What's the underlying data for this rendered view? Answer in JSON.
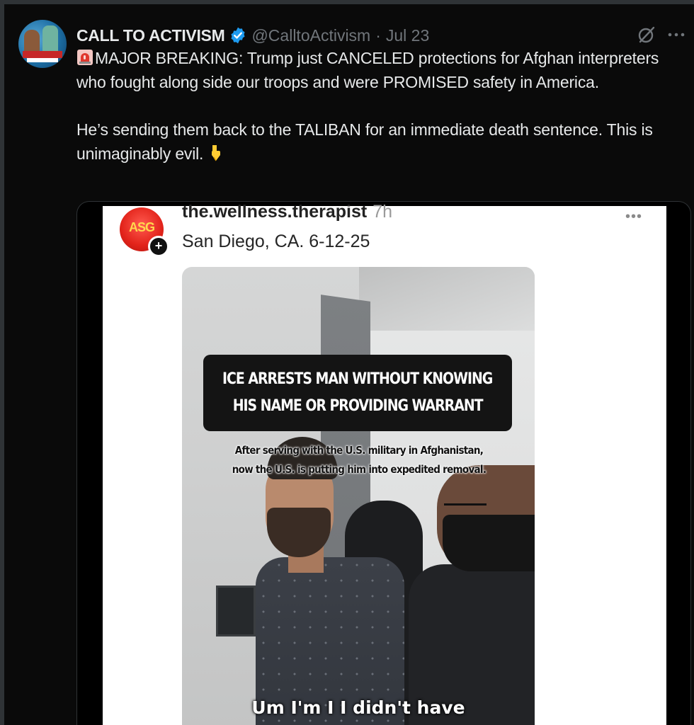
{
  "tweet": {
    "author_name": "CALL TO ACTIVISM",
    "handle": "@CalltoActivism",
    "separator": "·",
    "date": "Jul 23",
    "text_para1": "MAJOR BREAKING: Trump just CANCELED protections for Afghan interpreters who fought along side our troops and were PROMISED safety in America.",
    "text_para2": "He’s sending them back to the TALIBAN for an immediate death sentence. This is unimaginably evil.",
    "icons": {
      "verified": "verified-badge-icon",
      "grok": "grok-icon",
      "more": "more-options-icon",
      "siren": "siren-emoji",
      "pointing": "pointing-down-emoji"
    },
    "accent_color": "#1d9bf0"
  },
  "embedded_post": {
    "username": "the.wellness.therapist",
    "time": "7h",
    "more": "•••",
    "location": "San Diego, CA. 6-12-25",
    "avatar_text": "ASG",
    "video": {
      "caption_line1": "ICE ARRESTS MAN WITHOUT KNOWING",
      "caption_line2": "HIS NAME OR PROVIDING WARRANT",
      "sub_line1": "After serving with the U.S. military in Afghanistan,",
      "sub_line2": "now the U.S. is putting him into expedited removal.",
      "speech": "Um I'm I I didn't have"
    }
  }
}
